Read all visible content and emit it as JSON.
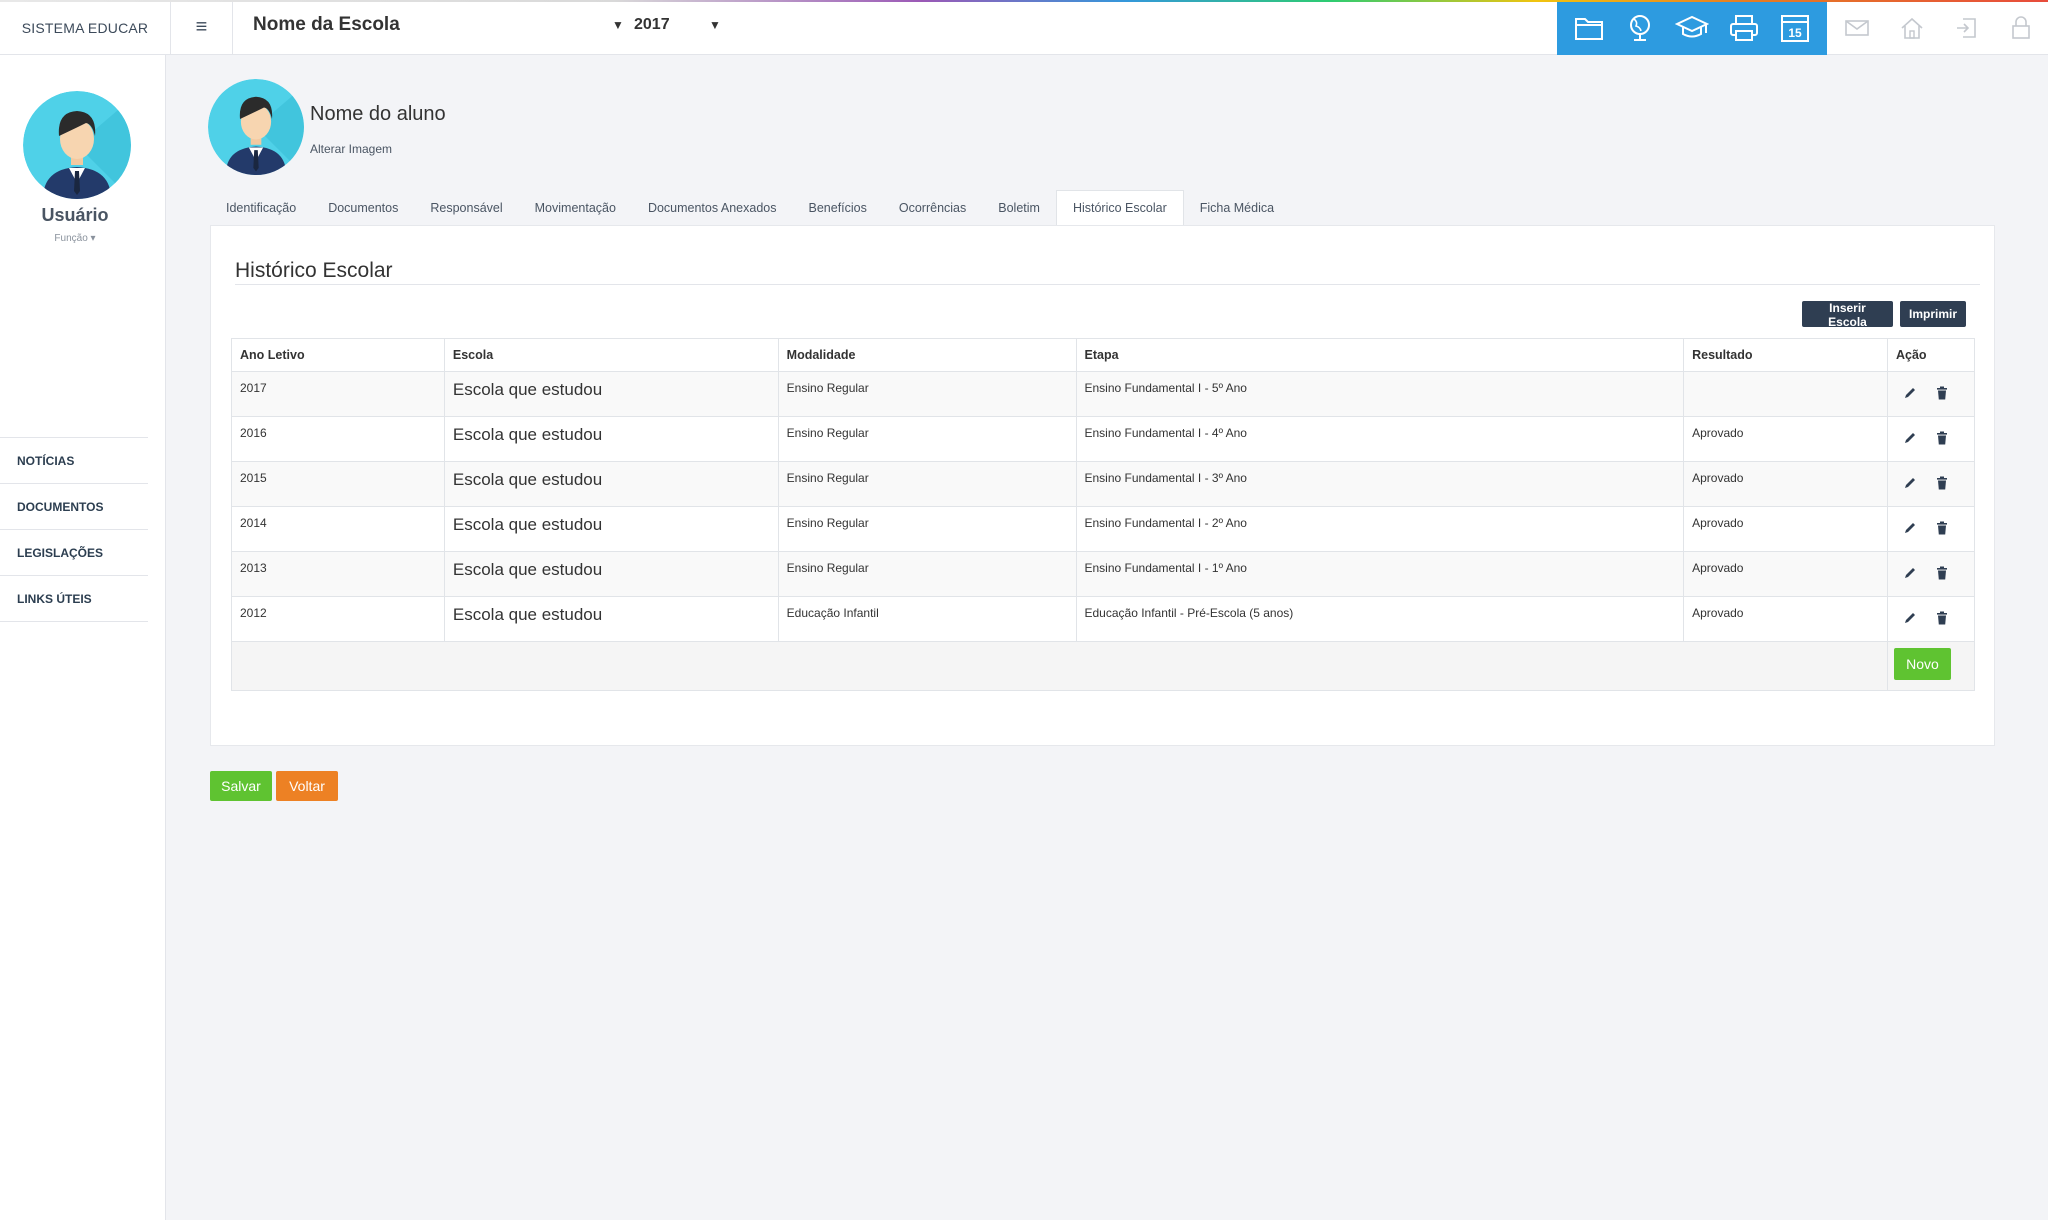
{
  "header": {
    "brand": "SISTEMA EDUCAR",
    "menu_glyph": "≡",
    "school_name": "Nome da Escola",
    "year": "2017",
    "calendar_day": "15",
    "blue_icons": [
      "folder-icon",
      "globe-icon",
      "graduation-cap-icon",
      "printer-icon",
      "calendar-icon"
    ],
    "gray_icons": [
      "mail-icon",
      "home-icon",
      "logout-icon",
      "lock-icon"
    ],
    "accent_color": "#2d9be0"
  },
  "sidebar": {
    "user_name": "Usuário",
    "user_role": "Função ▾",
    "nav": [
      {
        "label": "NOTÍCIAS"
      },
      {
        "label": "DOCUMENTOS"
      },
      {
        "label": "LEGISLAÇÕES"
      },
      {
        "label": "LINKS ÚTEIS"
      }
    ]
  },
  "student": {
    "name": "Nome do aluno",
    "change_image": "Alterar Imagem"
  },
  "tabs": [
    {
      "label": "Identificação"
    },
    {
      "label": "Documentos"
    },
    {
      "label": "Responsável"
    },
    {
      "label": "Movimentação"
    },
    {
      "label": "Documentos Anexados"
    },
    {
      "label": "Benefícios"
    },
    {
      "label": "Ocorrências"
    },
    {
      "label": "Boletim"
    },
    {
      "label": "Histórico Escolar",
      "active": true
    },
    {
      "label": "Ficha Médica"
    }
  ],
  "panel": {
    "title": "Histórico Escolar",
    "insert_school": "Inserir Escola",
    "print": "Imprimir",
    "new_button": "Novo",
    "columns": [
      "Ano Letivo",
      "Escola",
      "Modalidade",
      "Etapa",
      "Resultado",
      "Ação"
    ],
    "rows": [
      [
        "2017",
        "Escola que estudou",
        "Ensino Regular",
        "Ensino Fundamental I - 5º Ano",
        ""
      ],
      [
        "2016",
        "Escola que estudou",
        "Ensino Regular",
        "Ensino Fundamental I - 4º Ano",
        "Aprovado"
      ],
      [
        "2015",
        "Escola que estudou",
        "Ensino Regular",
        "Ensino Fundamental I - 3º Ano",
        "Aprovado"
      ],
      [
        "2014",
        "Escola que estudou",
        "Ensino Regular",
        "Ensino Fundamental I - 2º Ano",
        "Aprovado"
      ],
      [
        "2013",
        "Escola que estudou",
        "Ensino Regular",
        "Ensino Fundamental I - 1º Ano",
        "Aprovado"
      ],
      [
        "2012",
        "Escola que estudou",
        "Educação Infantil",
        "Educação Infantil - Pré-Escola (5 anos)",
        "Aprovado"
      ]
    ]
  },
  "footer_buttons": {
    "save": "Salvar",
    "back": "Voltar"
  }
}
